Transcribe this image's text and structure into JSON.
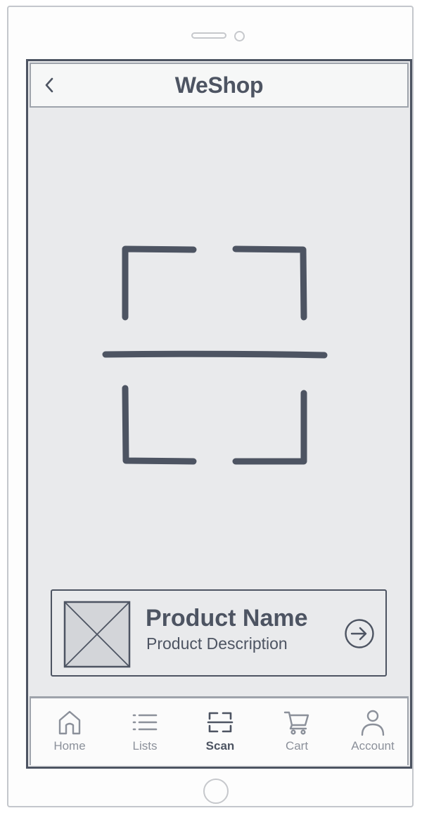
{
  "app": {
    "title": "WeShop"
  },
  "product": {
    "name": "Product Name",
    "description": "Product Description"
  },
  "tabs": [
    {
      "label": "Home",
      "icon": "home-icon"
    },
    {
      "label": "Lists",
      "icon": "list-icon"
    },
    {
      "label": "Scan",
      "icon": "scan-icon",
      "active": true
    },
    {
      "label": "Cart",
      "icon": "cart-icon"
    },
    {
      "label": "Account",
      "icon": "account-icon"
    }
  ],
  "colors": {
    "ink": "#4d5462",
    "screen_bg": "#e9eaec",
    "muted": "#8b909a",
    "frame": "#c4c7cc"
  }
}
